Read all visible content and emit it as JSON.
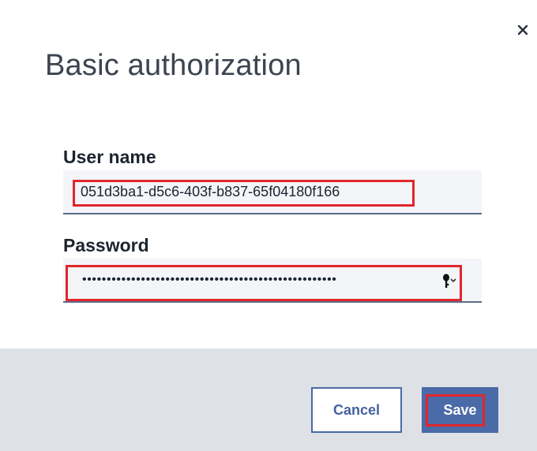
{
  "dialog": {
    "title": "Basic authorization",
    "close_icon": "close-icon"
  },
  "form": {
    "username": {
      "label": "User name",
      "value": "051d3ba1-d5c6-403f-b837-65f04180f166"
    },
    "password": {
      "label": "Password",
      "value": "••••••••••••••••••••••••••••••••••••••••••••••••••••",
      "icon": "key-icon"
    }
  },
  "footer": {
    "cancel_label": "Cancel",
    "save_label": "Save"
  },
  "colors": {
    "accent": "#4a6aa8",
    "highlight": "#e1262c",
    "footer_bg": "#dee1e6",
    "input_bg": "#f3f5f8"
  }
}
